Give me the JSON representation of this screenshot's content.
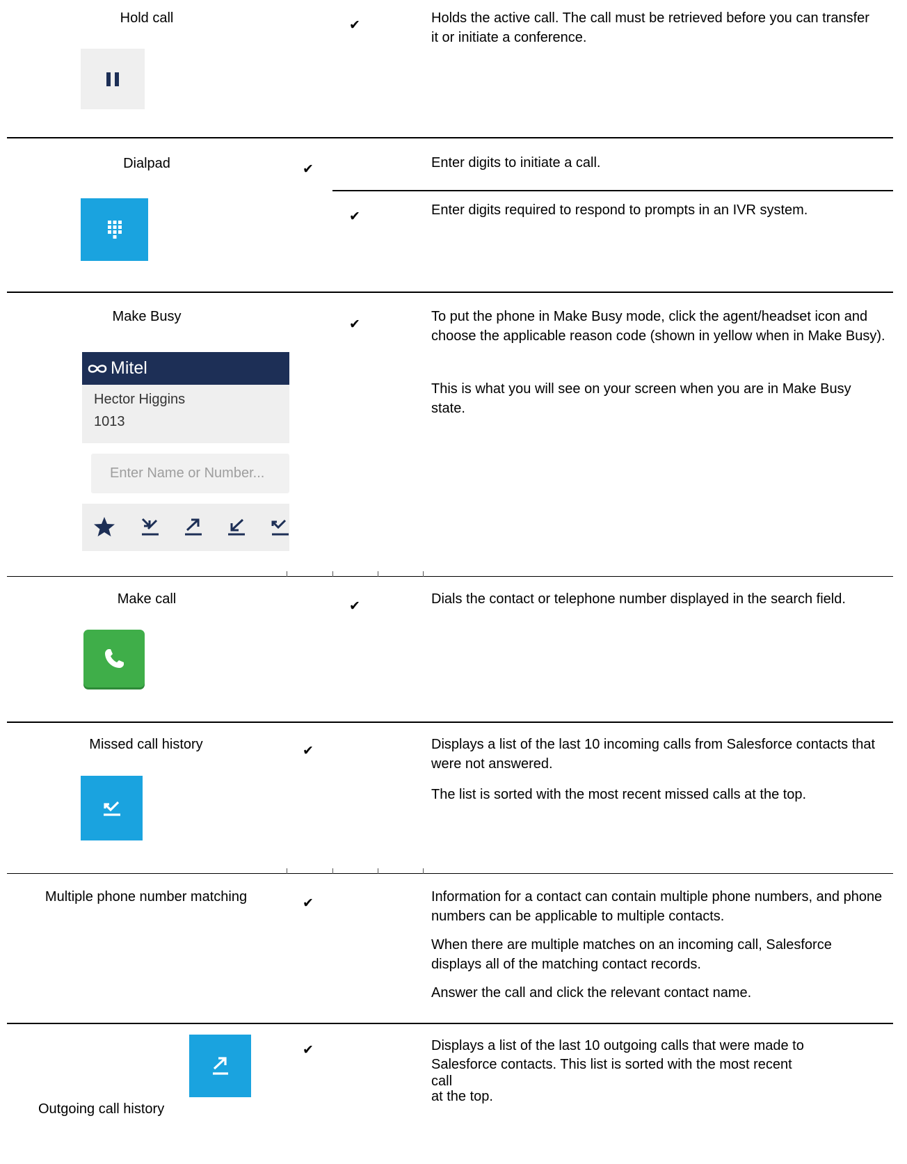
{
  "rows": [
    {
      "feature": "Hold call",
      "descriptions": [
        "Holds the active call. The call must be retrieved before you can transfer it or initiate a conference."
      ]
    },
    {
      "feature": "Dialpad",
      "descriptions": [
        "Enter digits to initiate a call.",
        "Enter digits required to respond to prompts in an IVR system."
      ]
    },
    {
      "feature": "Make Busy",
      "descriptions": [
        "To put the phone in Make Busy mode, click the agent/headset icon and choose the applicable reason code (shown in yellow when in Make Busy).",
        "This is what you will see on your screen when you are in Make Busy state."
      ],
      "widget": {
        "brand": "Mitel",
        "user_name": "Hector Higgins",
        "extension": "1013",
        "search_placeholder": "Enter Name or Number..."
      }
    },
    {
      "feature": "Make call",
      "descriptions": [
        "Dials the contact or telephone number displayed in the search field."
      ]
    },
    {
      "feature": "Missed call history",
      "descriptions": [
        "Displays a list of the last 10 incoming calls from Salesforce contacts that were not answered.",
        "The list is sorted with the most recent missed calls at the top."
      ]
    },
    {
      "feature": "Multiple phone number matching",
      "descriptions": [
        "Information for a contact can contain multiple phone numbers, and phone numbers can be applicable to multiple contacts.",
        "When there are multiple matches on an incoming call, Salesforce displays all of the matching contact records.",
        "Answer the call and click the relevant contact name."
      ]
    },
    {
      "feature": "Outgoing call history",
      "descriptions": [
        "Displays a list of the last 10 outgoing calls that were made to",
        "Salesforce contacts. This list is sorted with the most recent",
        "call",
        "at the top."
      ]
    }
  ],
  "check_symbol": "✔",
  "colors": {
    "icon_blue": "#1aa3df",
    "call_green": "#3fae49",
    "mitel_navy": "#1d2f56",
    "icon_grey_bg": "#efefef",
    "navy_icon": "#1d2f56"
  },
  "icons": [
    "pause-icon",
    "dialpad-icon",
    "star-icon",
    "call-history-icons",
    "phone-icon",
    "missed-call-icon",
    "outgoing-call-icon"
  ]
}
